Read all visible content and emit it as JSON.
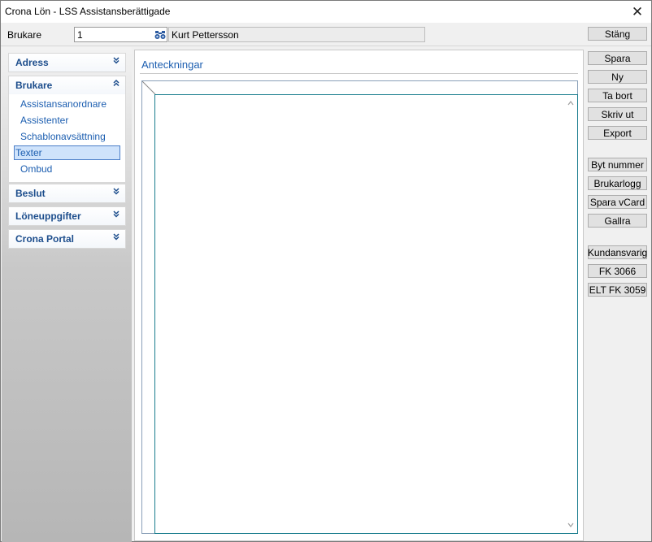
{
  "window": {
    "title": "Crona Lön - LSS Assistansberättigade",
    "close_glyph": "✕"
  },
  "userbar": {
    "label": "Brukare",
    "id_value": "1",
    "name_value": "Kurt Pettersson",
    "close_button": "Stäng"
  },
  "sidebar": {
    "groups": [
      {
        "title": "Adress",
        "chevron": "»",
        "expanded": false
      },
      {
        "title": "Brukare",
        "chevron": "«",
        "expanded": true,
        "items": [
          {
            "label": "Assistansanordnare",
            "selected": false
          },
          {
            "label": "Assistenter",
            "selected": false
          },
          {
            "label": "Schablonavsättning",
            "selected": false
          },
          {
            "label": "Texter",
            "selected": true
          },
          {
            "label": "Ombud",
            "selected": false
          }
        ]
      },
      {
        "title": "Beslut",
        "chevron": "»",
        "expanded": false
      },
      {
        "title": "Löneuppgifter",
        "chevron": "»",
        "expanded": false
      },
      {
        "title": "Crona Portal",
        "chevron": "»",
        "expanded": false
      }
    ]
  },
  "content": {
    "heading": "Anteckningar",
    "notes_text": ""
  },
  "actions": {
    "group1": [
      "Spara",
      "Ny",
      "Ta bort",
      "Skriv ut",
      "Export"
    ],
    "group2": [
      "Byt nummer",
      "Brukarlogg",
      "Spara vCard",
      "Gallra"
    ],
    "group3": [
      "Kundansvarig",
      "FK 3066",
      "ELT FK 3059"
    ]
  },
  "colors": {
    "accent": "#1c5eb0",
    "heading_blue": "#1c4d8c",
    "selection_bg": "#cfe3fb",
    "editor_border": "#1a7d8e"
  }
}
